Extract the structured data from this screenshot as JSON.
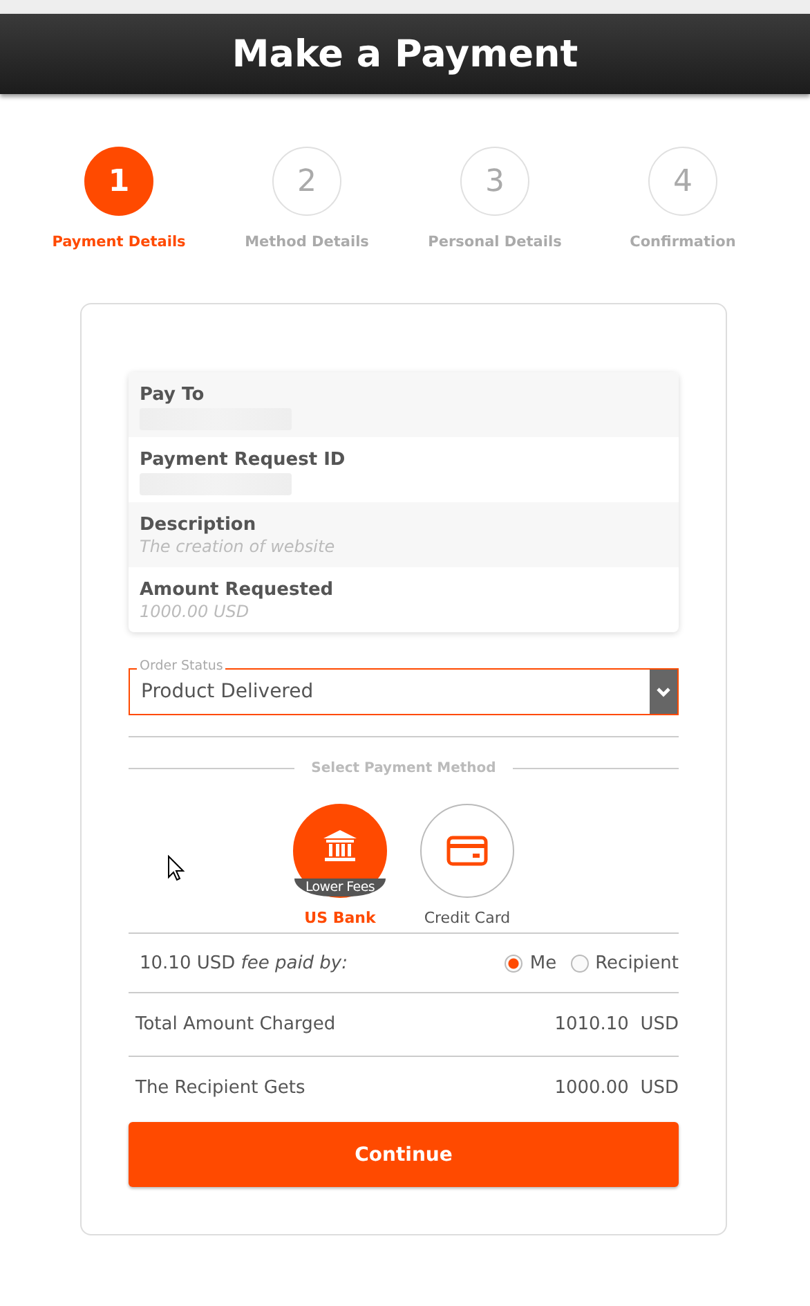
{
  "header": {
    "title": "Make a Payment"
  },
  "steps": [
    {
      "number": "1",
      "label": "Payment Details",
      "selected": true
    },
    {
      "number": "2",
      "label": "Method Details",
      "selected": false
    },
    {
      "number": "3",
      "label": "Personal Details",
      "selected": false
    },
    {
      "number": "4",
      "label": "Confirmation",
      "selected": false
    }
  ],
  "details": [
    {
      "label": "Pay To",
      "value_redacted": true
    },
    {
      "label": "Payment Request ID",
      "value_redacted": true
    },
    {
      "label": "Description",
      "value": "The creation of website"
    },
    {
      "label": "Amount Requested",
      "value": "1000.00 USD"
    }
  ],
  "order_status": {
    "label": "Order Status",
    "value": "Product Delivered"
  },
  "payment_method": {
    "heading": "Select Payment Method",
    "options": [
      {
        "kind": "bank",
        "label": "US Bank",
        "ribbon": "Lower Fees",
        "selected": true
      },
      {
        "kind": "card",
        "label": "Credit Card",
        "selected": false
      }
    ]
  },
  "fee": {
    "amount": "10.10 USD",
    "text": "fee paid by:",
    "payers": [
      {
        "label": "Me",
        "selected": true
      },
      {
        "label": "Recipient",
        "selected": false
      }
    ]
  },
  "totals": [
    {
      "label": "Total Amount Charged",
      "amount": "1010.10",
      "currency": "USD"
    },
    {
      "label": "The Recipient Gets",
      "amount": "1000.00",
      "currency": "USD"
    }
  ],
  "continue_button": "Continue"
}
